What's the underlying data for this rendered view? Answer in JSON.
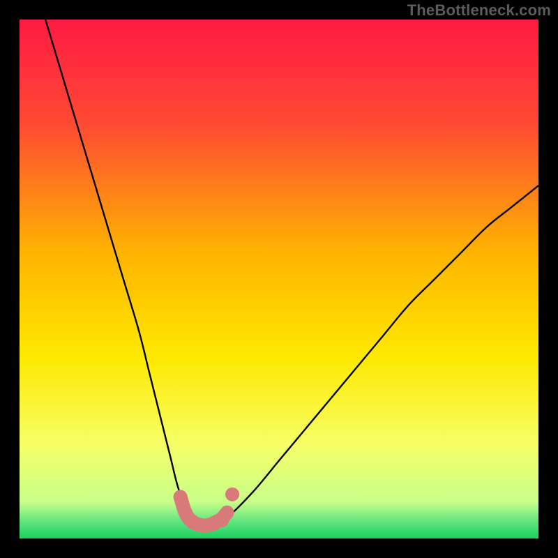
{
  "watermark": "TheBottleneck.com",
  "chart_data": {
    "type": "line",
    "title": "",
    "xlabel": "",
    "ylabel": "",
    "xlim": [
      0,
      100
    ],
    "ylim": [
      0,
      100
    ],
    "grid": false,
    "series": [
      {
        "name": "bottleneck-curve",
        "x": [
          5,
          8,
          11,
          14,
          17,
          20,
          23,
          25,
          27,
          29,
          30.5,
          32,
          33.5,
          35,
          37,
          40,
          45,
          50,
          55,
          60,
          65,
          70,
          75,
          80,
          85,
          90,
          95,
          100
        ],
        "y": [
          100,
          90,
          80,
          70,
          60,
          50,
          40,
          32,
          24,
          16,
          10,
          6,
          3,
          2,
          2,
          4,
          9,
          15,
          21,
          27,
          33,
          39,
          45,
          50,
          55,
          60,
          64,
          68
        ]
      }
    ],
    "flat_region": {
      "x_start": 31,
      "x_end": 40,
      "y": 3
    },
    "markers": [
      {
        "series": "bottleneck-curve",
        "x": 31,
        "y": 8
      },
      {
        "series": "bottleneck-curve",
        "x": 32,
        "y": 5
      },
      {
        "series": "bottleneck-curve",
        "x": 33.5,
        "y": 3
      },
      {
        "series": "bottleneck-curve",
        "x": 35.5,
        "y": 2.5
      },
      {
        "series": "bottleneck-curve",
        "x": 37.5,
        "y": 2.8
      },
      {
        "series": "bottleneck-curve",
        "x": 39,
        "y": 3.5
      },
      {
        "series": "bottleneck-curve",
        "x": 41,
        "y": 8.5
      }
    ],
    "gradient_stops": [
      {
        "offset": 0.0,
        "color": "#ff1a44"
      },
      {
        "offset": 0.2,
        "color": "#ff4a33"
      },
      {
        "offset": 0.45,
        "color": "#ffb400"
      },
      {
        "offset": 0.65,
        "color": "#ffe900"
      },
      {
        "offset": 0.82,
        "color": "#f6ff66"
      },
      {
        "offset": 0.93,
        "color": "#c8ff8a"
      },
      {
        "offset": 0.965,
        "color": "#66e680"
      },
      {
        "offset": 1.0,
        "color": "#18d160"
      }
    ],
    "marker_style": {
      "fill": "#d97a7a",
      "stroke": "#d97a7a",
      "radius_px": 10
    }
  }
}
